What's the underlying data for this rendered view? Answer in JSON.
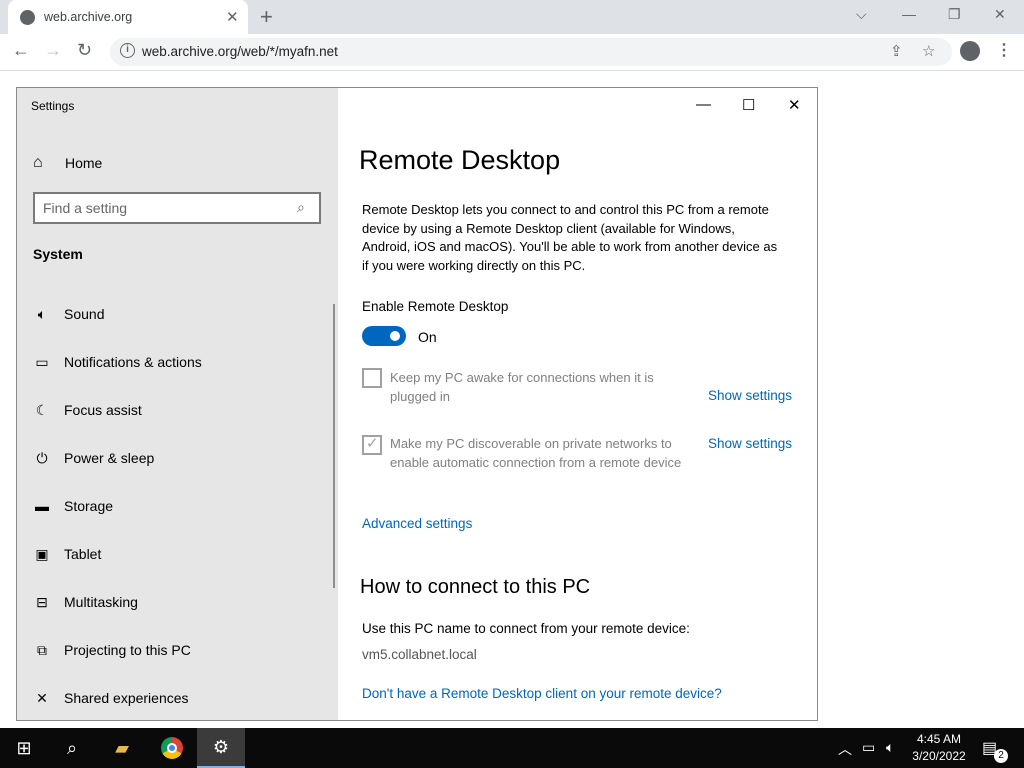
{
  "browser": {
    "tab_title": "web.archive.org",
    "tab_close": "✕",
    "new_tab": "+",
    "url": "web.archive.org/web/*/myafn.net",
    "icons": [
      "back-icon",
      "forward-icon",
      "reload-icon",
      "share-icon",
      "star-icon",
      "profile-icon",
      "menu-icon"
    ]
  },
  "settings": {
    "app_title": "Settings",
    "home_label": "Home",
    "search_placeholder": "Find a setting",
    "section": "System",
    "nav_items": [
      {
        "label": "Sound",
        "icon": "speaker-icon"
      },
      {
        "label": "Notifications & actions",
        "icon": "notification-icon"
      },
      {
        "label": "Focus assist",
        "icon": "moon-icon"
      },
      {
        "label": "Power & sleep",
        "icon": "power-icon"
      },
      {
        "label": "Storage",
        "icon": "storage-icon"
      },
      {
        "label": "Tablet",
        "icon": "tablet-icon"
      },
      {
        "label": "Multitasking",
        "icon": "multitasking-icon"
      },
      {
        "label": "Projecting to this PC",
        "icon": "projecting-icon"
      },
      {
        "label": "Shared experiences",
        "icon": "shared-experiences-icon"
      }
    ],
    "page_title": "Remote Desktop",
    "description": "Remote Desktop lets you connect to and control this PC from a remote device by using a Remote Desktop client (available for Windows, Android, iOS and macOS). You'll be able to work from another device as if you were working directly on this PC.",
    "enable_label": "Enable Remote Desktop",
    "toggle_state": "On",
    "toggle_on": true,
    "keep_awake_text": "Keep my PC awake for connections when it is plugged in",
    "keep_awake_checked": false,
    "discoverable_text": "Make my PC discoverable on private networks to enable automatic connection from a remote device",
    "discoverable_checked": true,
    "show_settings": "Show settings",
    "advanced_settings": "Advanced settings",
    "connect_heading": "How to connect to this PC",
    "connect_text": "Use this PC name to connect from your remote device:",
    "pc_name": "vm5.collabnet.local",
    "client_link": "Don't have a Remote Desktop client on your remote device?",
    "accent_color": "#0067c0"
  },
  "taskbar": {
    "time": "4:45 AM",
    "date": "3/20/2022",
    "notification_count": "2"
  }
}
